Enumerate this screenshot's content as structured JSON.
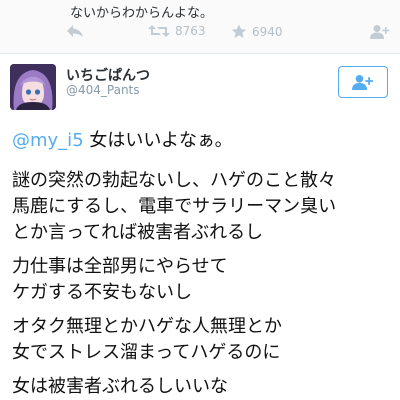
{
  "previous_tweet": {
    "text": "ないからわからんよな。",
    "retweet_count": "8763",
    "favorite_count": "6940"
  },
  "tweet": {
    "user_name": "いちごぱんつ",
    "handle": "@404_Pants",
    "mention": "@my_i5",
    "reply_text": " 女はいいよなぁ。",
    "paragraphs": [
      [
        "謎の突然の勃起ないし、ハゲのこと散々",
        "馬鹿にするし、電車でサラリーマン臭い",
        "とか言ってれば被害者ぶれるし"
      ],
      [
        "力仕事は全部男にやらせて",
        "ケガする不安もないし"
      ],
      [
        "オタク無理とかハゲな人無理とか",
        "女でストレス溜まってハゲるのに"
      ],
      [
        "女は被害者ぶれるしいいな"
      ]
    ]
  },
  "colors": {
    "link": "#55acee",
    "action_gray": "#b5bec6",
    "handle_gray": "#8899a6"
  },
  "icons": {
    "reply": "reply-arrow-icon",
    "retweet": "retweet-icon",
    "favorite": "star-icon",
    "follow": "add-person-icon",
    "more": "add-person-icon"
  }
}
